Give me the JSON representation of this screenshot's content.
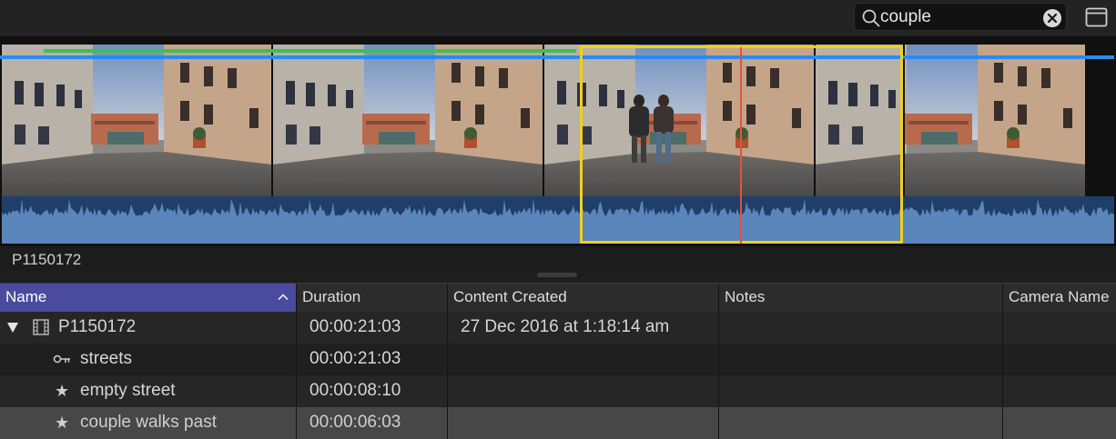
{
  "search": {
    "value": "couple",
    "icon": "search-icon",
    "clear_icon": "clear-circle-icon"
  },
  "toolbar": {
    "viewer_toggle_icon": "window-icon"
  },
  "filmstrip": {
    "clip_name": "P1150172",
    "accent_green": "#39c15a",
    "accent_blue": "#2a8af0",
    "selection_color": "#f0d01c",
    "playhead_color": "#e0533c"
  },
  "list": {
    "columns": [
      {
        "label": "Name",
        "sorted": "ascending"
      },
      {
        "label": "Duration"
      },
      {
        "label": "Content Created"
      },
      {
        "label": "Notes"
      },
      {
        "label": "Camera Name"
      }
    ],
    "rows": [
      {
        "name": "P1150172",
        "icon": "film-icon",
        "expanded": true,
        "duration": "00:00:21:03",
        "content_created": "27 Dec 2016 at 1:18:14 am",
        "notes": "",
        "camera": ""
      },
      {
        "name": "streets",
        "icon": "key-icon",
        "duration": "00:00:21:03",
        "content_created": "",
        "notes": "",
        "camera": ""
      },
      {
        "name": "empty street",
        "icon": "star-icon",
        "star": "★",
        "duration": "00:00:08:10",
        "content_created": "",
        "notes": "",
        "camera": ""
      },
      {
        "name": "couple walks past",
        "icon": "star-icon",
        "star": "★",
        "duration": "00:00:06:03",
        "content_created": "",
        "notes": "",
        "camera": "",
        "selected": true
      }
    ],
    "sorted_column_color": "#4a4a9e"
  }
}
